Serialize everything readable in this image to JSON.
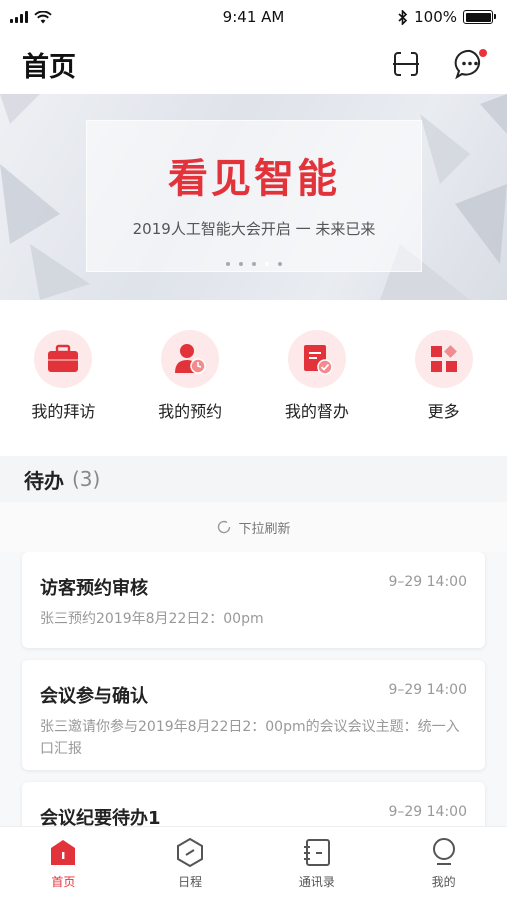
{
  "status_bar": {
    "time": "9:41 AM",
    "battery": "100%"
  },
  "header": {
    "title": "首页",
    "scan_icon": "scan-icon",
    "message_icon": "message-bubble-icon"
  },
  "banner": {
    "headline": "看见智能",
    "subtitle": "2019人工智能大会开启 一 未来已来",
    "slide_count": 5,
    "active_slide": 4
  },
  "quick_actions": [
    {
      "label": "我的拜访",
      "icon": "briefcase-icon"
    },
    {
      "label": "我的预约",
      "icon": "person-clock-icon"
    },
    {
      "label": "我的督办",
      "icon": "task-check-icon"
    },
    {
      "label": "更多",
      "icon": "grid-more-icon"
    }
  ],
  "todo": {
    "title": "待办",
    "count": "(3)",
    "refresh_hint": "下拉刷新"
  },
  "todo_items": [
    {
      "title": "访客预约审核",
      "time": "9–29 14:00",
      "desc": "张三预约2019年8月22日2：00pm"
    },
    {
      "title": "会议参与确认",
      "time": "9–29 14:00",
      "desc": "张三邀请你参与2019年8月22日2：00pm的会议会议主题：统一入口汇报"
    },
    {
      "title": "会议纪要待办1",
      "time": "9–29 14:00",
      "desc": ""
    }
  ],
  "tabs": [
    {
      "label": "首页",
      "icon": "home-icon",
      "active": true
    },
    {
      "label": "日程",
      "icon": "schedule-icon",
      "active": false
    },
    {
      "label": "通讯录",
      "icon": "contacts-icon",
      "active": false
    },
    {
      "label": "我的",
      "icon": "profile-icon",
      "active": false
    }
  ],
  "colors": {
    "accent": "#e2333b",
    "accent_light": "#fde9ea",
    "muted": "#999999"
  }
}
